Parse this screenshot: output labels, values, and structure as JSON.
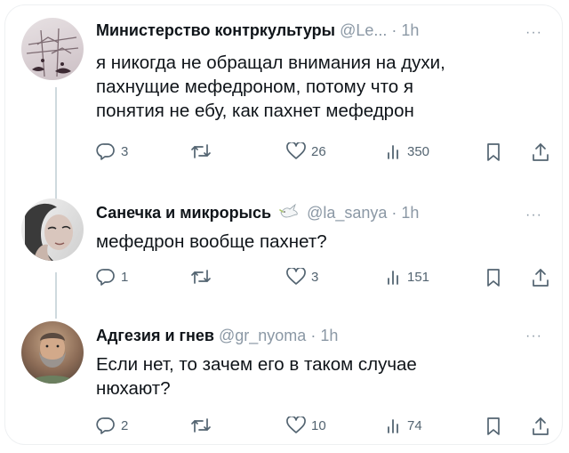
{
  "tweets": [
    {
      "name": "Министерство контркультуры",
      "handle": "@Le...",
      "time": "· 1h",
      "more": "···",
      "lines": [
        "я никогда не обращал внимания на духи,",
        "пахнущие мефедроном, потому что я",
        "понятия не ебу, как пахнет мефедрон"
      ],
      "replies": "3",
      "reposts": "",
      "likes": "26",
      "views": "350"
    },
    {
      "name": "Санечка и микрорысь",
      "handle": "@la_sanya",
      "time": "· 1h",
      "more": "···",
      "lines": [
        "мефедрон вообще пахнет?"
      ],
      "replies": "1",
      "reposts": "",
      "likes": "3",
      "views": "151"
    },
    {
      "name": "Адгезия и гнев",
      "handle": "@gr_nyoma",
      "time": "· 1h",
      "more": "···",
      "lines": [
        "Если нет, то зачем его в таком случае",
        "нюхают?"
      ],
      "replies": "2",
      "reposts": "",
      "likes": "10",
      "views": "74"
    }
  ],
  "icons": {
    "reply": "reply-icon",
    "repost": "repost-icon",
    "like": "like-icon",
    "views": "views-icon",
    "bookmark": "bookmark-icon",
    "share": "share-icon",
    "dove": "dove-emoji-icon"
  },
  "colors": {
    "text": "#0f1419",
    "secondary": "#536471",
    "handle": "#8b98a5",
    "thread_line": "#cfd9de"
  }
}
